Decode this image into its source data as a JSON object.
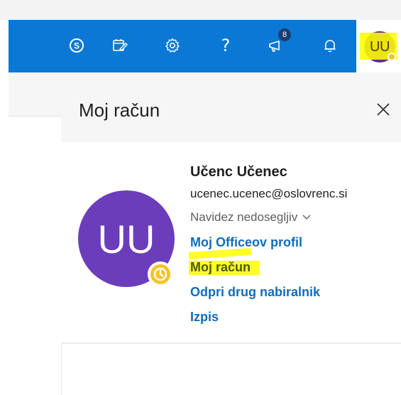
{
  "topbar": {
    "icons": [
      {
        "name": "skype-icon"
      },
      {
        "name": "my-day-icon"
      },
      {
        "name": "gear-icon"
      },
      {
        "name": "help-icon",
        "glyph": "?"
      },
      {
        "name": "feedback-icon",
        "badge": "8"
      },
      {
        "name": "bell-icon"
      }
    ],
    "avatar_initials": "UU",
    "accent": "#0a78d4"
  },
  "panel": {
    "title": "Moj račun",
    "close_glyph": "✕",
    "user": {
      "initials": "UU",
      "name": "Učenc Učenec",
      "email": "ucenec.ucenec@oslovrenc.si",
      "status": "Navidez nedosegljiv",
      "status_color": "#f8c323",
      "avatar_color": "#6b3dbb"
    },
    "links": {
      "profile": "Moj Officeov profil",
      "account": "Moj račun",
      "open_mailbox": "Odpri drug nabiralnik",
      "sign_out": "Izpis"
    }
  }
}
